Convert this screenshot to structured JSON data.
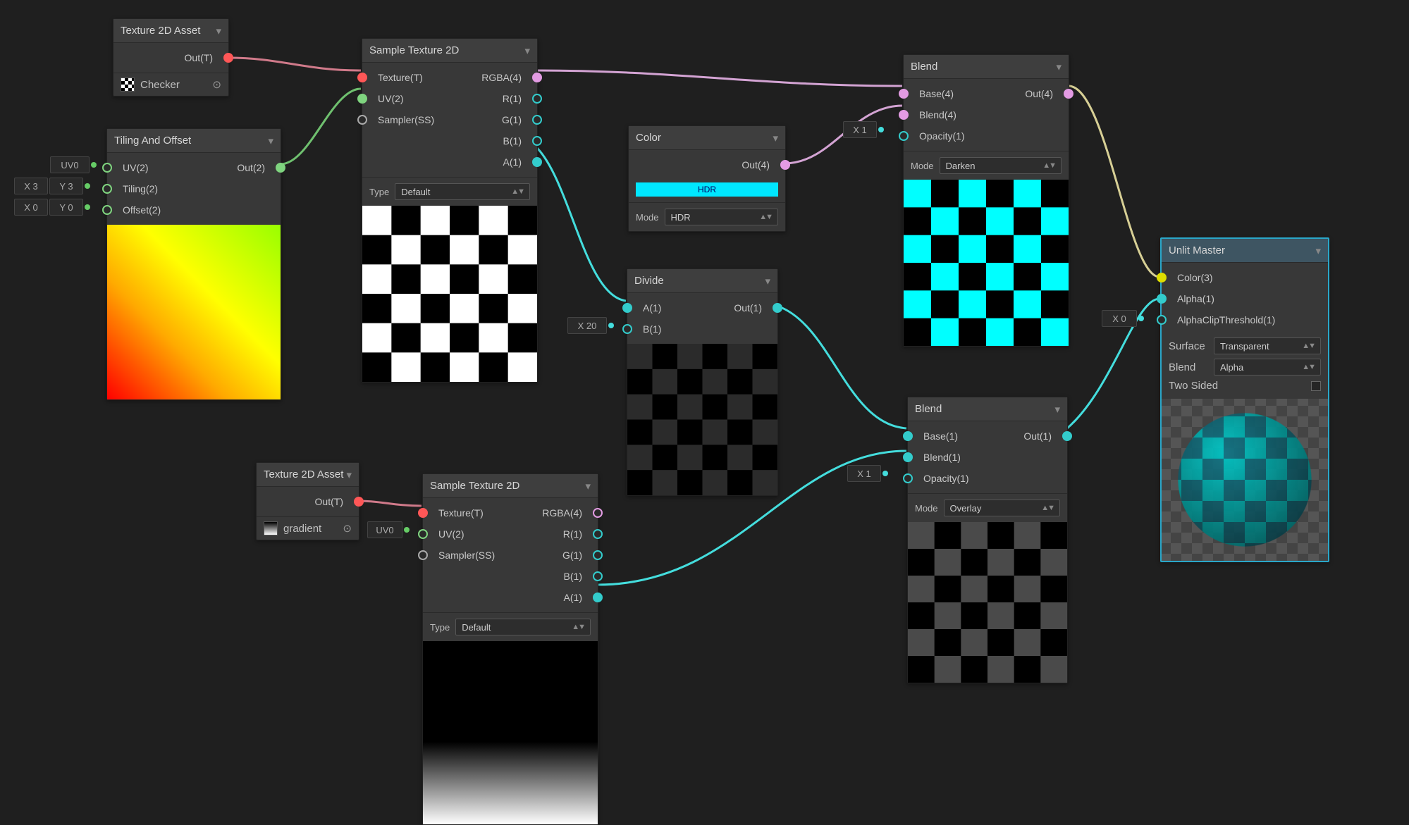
{
  "colors": {
    "accent": "#00e7ff",
    "cyan": "#00ffff",
    "bg": "#1f1f1f"
  },
  "nodes": {
    "texAsset1": {
      "title": "Texture 2D Asset",
      "out": "Out(T)",
      "asset": "Checker"
    },
    "texAsset2": {
      "title": "Texture 2D Asset",
      "out": "Out(T)",
      "asset": "gradient"
    },
    "tiling": {
      "title": "Tiling And Offset",
      "inputs": [
        "UV(2)",
        "Tiling(2)",
        "Offset(2)"
      ],
      "out": "Out(2)",
      "dock_uv": "UV0",
      "tiling_x": "X 3",
      "tiling_y": "Y 3",
      "offset_x": "X 0",
      "offset_y": "Y 0"
    },
    "sample1": {
      "title": "Sample Texture 2D",
      "ins": [
        "Texture(T)",
        "UV(2)",
        "Sampler(SS)"
      ],
      "outs": [
        "RGBA(4)",
        "R(1)",
        "G(1)",
        "B(1)",
        "A(1)"
      ],
      "type_label": "Type",
      "type_value": "Default"
    },
    "sample2": {
      "title": "Sample Texture 2D",
      "ins": [
        "Texture(T)",
        "UV(2)",
        "Sampler(SS)"
      ],
      "outs": [
        "RGBA(4)",
        "R(1)",
        "G(1)",
        "B(1)",
        "A(1)"
      ],
      "type_label": "Type",
      "type_value": "Default",
      "uv_dock": "UV0"
    },
    "color": {
      "title": "Color",
      "out": "Out(4)",
      "mode_label": "Mode",
      "mode_value": "HDR",
      "swatch": "HDR"
    },
    "divide": {
      "title": "Divide",
      "a": "A(1)",
      "b": "B(1)",
      "out": "Out(1)",
      "dock_b": "X 20"
    },
    "blend1": {
      "title": "Blend",
      "ins": [
        "Base(4)",
        "Blend(4)",
        "Opacity(1)"
      ],
      "out": "Out(4)",
      "mode_label": "Mode",
      "mode_value": "Darken",
      "dock_op": "X 1"
    },
    "blend2": {
      "title": "Blend",
      "ins": [
        "Base(1)",
        "Blend(1)",
        "Opacity(1)"
      ],
      "out": "Out(1)",
      "mode_label": "Mode",
      "mode_value": "Overlay",
      "dock_op": "X 1"
    },
    "master": {
      "title": "Unlit Master",
      "ins": [
        "Color(3)",
        "Alpha(1)",
        "AlphaClipThreshold(1)"
      ],
      "surface_label": "Surface",
      "surface_value": "Transparent",
      "blend_label": "Blend",
      "blend_value": "Alpha",
      "two_sided": "Two Sided",
      "dock_clip": "X  0"
    }
  }
}
